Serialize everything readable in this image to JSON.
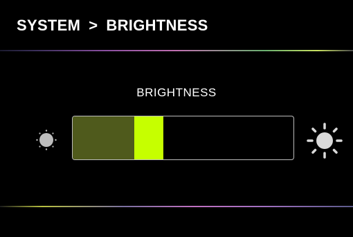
{
  "header": {
    "crumb_system": "SYSTEM",
    "crumb_separator": ">",
    "crumb_brightness": "BRIGHTNESS"
  },
  "main": {
    "title": "BRIGHTNESS"
  },
  "brightness": {
    "level_percent": 32,
    "min_icon": "sun-dim-icon",
    "max_icon": "sun-bright-icon"
  },
  "colors": {
    "background": "#000000",
    "text": "#ffffff",
    "slider_fill": "#4f5a1c",
    "slider_thumb": "#c6ff00",
    "slider_border": "#bdbdbd"
  }
}
